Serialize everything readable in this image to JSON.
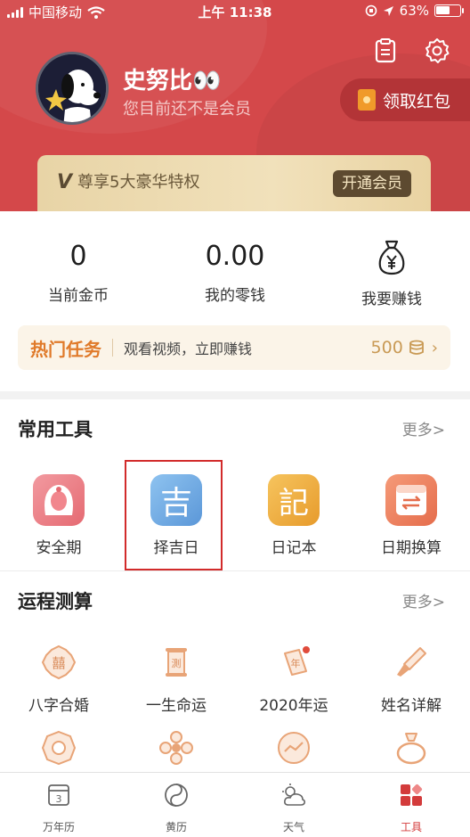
{
  "status_bar": {
    "carrier": "中国移动",
    "time": "上午 11:38",
    "battery": "63%",
    "battery_level": 0.63
  },
  "profile": {
    "name": "史努比👀",
    "member_status": "您目前还不是会员",
    "redpacket_label": "领取红包"
  },
  "vip_banner": {
    "badge": "V",
    "text": "尊享5大豪华特权",
    "button": "开通会员"
  },
  "stats": [
    {
      "value": "0",
      "label": "当前金币"
    },
    {
      "value": "0.00",
      "label": "我的零钱"
    },
    {
      "value": "",
      "label": "我要赚钱",
      "icon": "money-bag-icon"
    }
  ],
  "task": {
    "title": "热门任务",
    "desc": "观看视频，立即赚钱",
    "amount": "500"
  },
  "common_tools": {
    "title": "常用工具",
    "more": "更多>",
    "items": [
      {
        "label": "安全期",
        "icon": "safe-period-icon",
        "color": "#e9757a"
      },
      {
        "label": "择吉日",
        "icon": "auspicious-day-icon",
        "glyph": "吉",
        "color": "#6fa8e0"
      },
      {
        "label": "日记本",
        "icon": "diary-icon",
        "glyph": "記",
        "color": "#eaa63b"
      },
      {
        "label": "日期换算",
        "icon": "date-convert-icon",
        "color": "#ec7d5b"
      }
    ]
  },
  "fortune": {
    "title": "运程测算",
    "more": "更多>",
    "items": [
      {
        "label": "八字合婚",
        "icon": "bazi-marriage-icon"
      },
      {
        "label": "一生命运",
        "icon": "life-destiny-icon"
      },
      {
        "label": "2020年运",
        "icon": "year-fortune-icon"
      },
      {
        "label": "姓名详解",
        "icon": "name-analysis-icon"
      }
    ],
    "row2_icons": [
      "bagua-icon",
      "flower-icon",
      "trend-icon",
      "ring-icon"
    ]
  },
  "tabbar": [
    {
      "label": "万年历",
      "icon": "calendar-icon",
      "glyph": "3"
    },
    {
      "label": "黄历",
      "icon": "yinyang-icon"
    },
    {
      "label": "天气",
      "icon": "weather-icon"
    },
    {
      "label": "工具",
      "icon": "tools-icon",
      "active": true
    }
  ],
  "colors": {
    "header_red": "#d4484a",
    "accent_orange": "#e07a2a",
    "gold": "#c99a55",
    "active_tab": "#d33b3b"
  }
}
